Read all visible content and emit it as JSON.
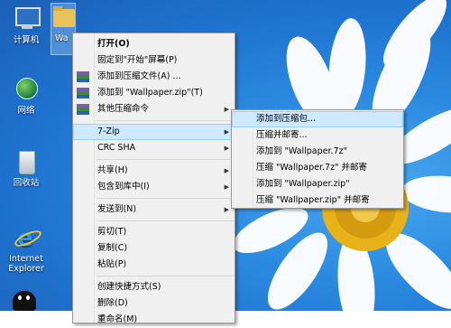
{
  "desktop_icons": [
    {
      "label": "计算机"
    },
    {
      "label": "Wa"
    },
    {
      "label": "网络"
    },
    {
      "label": "回收站"
    },
    {
      "label": "Internet Explorer"
    }
  ],
  "context_menu": {
    "items": [
      {
        "label": "打开(O)",
        "bold": true
      },
      {
        "label": "固定到\"开始\"屏幕(P)"
      },
      {
        "label": "添加到压缩文件(A) ...",
        "icon": "winrar-icon"
      },
      {
        "label": "添加到 \"Wallpaper.zip\"(T)",
        "icon": "winrar-icon"
      },
      {
        "label": "其他压缩命令",
        "icon": "winrar-icon",
        "submenu": true
      },
      {
        "label": "7-Zip",
        "submenu": true,
        "highlighted": true
      },
      {
        "label": "CRC SHA",
        "submenu": true
      },
      {
        "label": "共享(H)",
        "submenu": true
      },
      {
        "label": "包含到库中(I)",
        "submenu": true
      },
      {
        "label": "发送到(N)",
        "submenu": true
      },
      {
        "label": "剪切(T)"
      },
      {
        "label": "复制(C)"
      },
      {
        "label": "粘贴(P)"
      },
      {
        "label": "创建快捷方式(S)"
      },
      {
        "label": "删除(D)"
      },
      {
        "label": "重命名(M)"
      }
    ]
  },
  "zip_submenu": {
    "items": [
      {
        "label": "添加到压缩包...",
        "highlighted": true
      },
      {
        "label": "压缩并邮寄..."
      },
      {
        "label": "添加到 \"Wallpaper.7z\""
      },
      {
        "label": "压缩 \"Wallpaper.7z\" 并邮寄"
      },
      {
        "label": "添加到 \"Wallpaper.zip\""
      },
      {
        "label": "压缩 \"Wallpaper.zip\" 并邮寄"
      }
    ]
  },
  "colors": {
    "highlight": "#cde8ff",
    "menu_bg": "#f0f0f0",
    "desktop": "#2b8ae0"
  }
}
